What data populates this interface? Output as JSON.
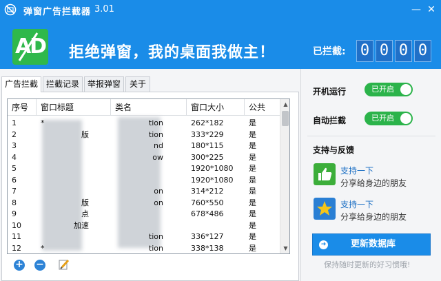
{
  "app": {
    "title": "弹窗广告拦截器",
    "version": "3.01",
    "slogan": "拒绝弹窗，我的桌面我做主！",
    "blocked_label": "已拦截:",
    "blocked_digits": [
      "0",
      "0",
      "0",
      "0"
    ],
    "logo_text": "AD",
    "window_buttons": {
      "minimize": "—",
      "close": "✕"
    }
  },
  "tabs": [
    {
      "label": "广告拦截",
      "active": true
    },
    {
      "label": "拦截记录",
      "active": false
    },
    {
      "label": "举报弹窗",
      "active": false
    },
    {
      "label": "关于",
      "active": false
    }
  ],
  "table": {
    "columns": [
      "序号",
      "窗口标题",
      "类名",
      "窗口大小",
      "公共"
    ],
    "rows": [
      {
        "no": "1",
        "title": "*",
        "cls": "tion",
        "size": "262*182",
        "pub": "是"
      },
      {
        "no": "2",
        "title": "版",
        "cls": "tion",
        "size": "333*229",
        "pub": "是"
      },
      {
        "no": "3",
        "title": "",
        "cls": "nd",
        "size": "180*115",
        "pub": "是"
      },
      {
        "no": "4",
        "title": "",
        "cls": "ow",
        "size": "300*225",
        "pub": "是"
      },
      {
        "no": "5",
        "title": "",
        "cls": "",
        "size": "1920*1080",
        "pub": "是"
      },
      {
        "no": "6",
        "title": "",
        "cls": "",
        "size": "1920*1080",
        "pub": "是"
      },
      {
        "no": "7",
        "title": "",
        "cls": "on",
        "size": "314*212",
        "pub": "是"
      },
      {
        "no": "8",
        "title": "版",
        "cls": "on",
        "size": "760*550",
        "pub": "是"
      },
      {
        "no": "9",
        "title": "点",
        "cls": "",
        "size": "678*486",
        "pub": "是"
      },
      {
        "no": "10",
        "title": "加速",
        "cls": "",
        "size": "",
        "pub": "是"
      },
      {
        "no": "11",
        "title": "",
        "cls": "tion",
        "size": "336*127",
        "pub": "是"
      },
      {
        "no": "12",
        "title": "*",
        "cls": "tion",
        "size": "338*138",
        "pub": "是"
      }
    ]
  },
  "toolbar": {
    "add": "+",
    "remove": "−"
  },
  "options": [
    {
      "label": "开机运行",
      "state": "已开启"
    },
    {
      "label": "自动拦截",
      "state": "已开启"
    }
  ],
  "support": {
    "title": "支持与反馈",
    "items": [
      {
        "title": "支持一下",
        "subtitle": "分享给身边的朋友",
        "icon": "thumbs-up-icon"
      },
      {
        "title": "支持一下",
        "subtitle": "分享给身边的朋友",
        "icon": "star-icon"
      }
    ]
  },
  "update": {
    "label": "更新数据库",
    "hint": "保持随时更新的好习惯哦!"
  },
  "colors": {
    "header": "#1a8ce8",
    "toggle_on": "#2bb34a",
    "logo": "#2fb84b"
  }
}
